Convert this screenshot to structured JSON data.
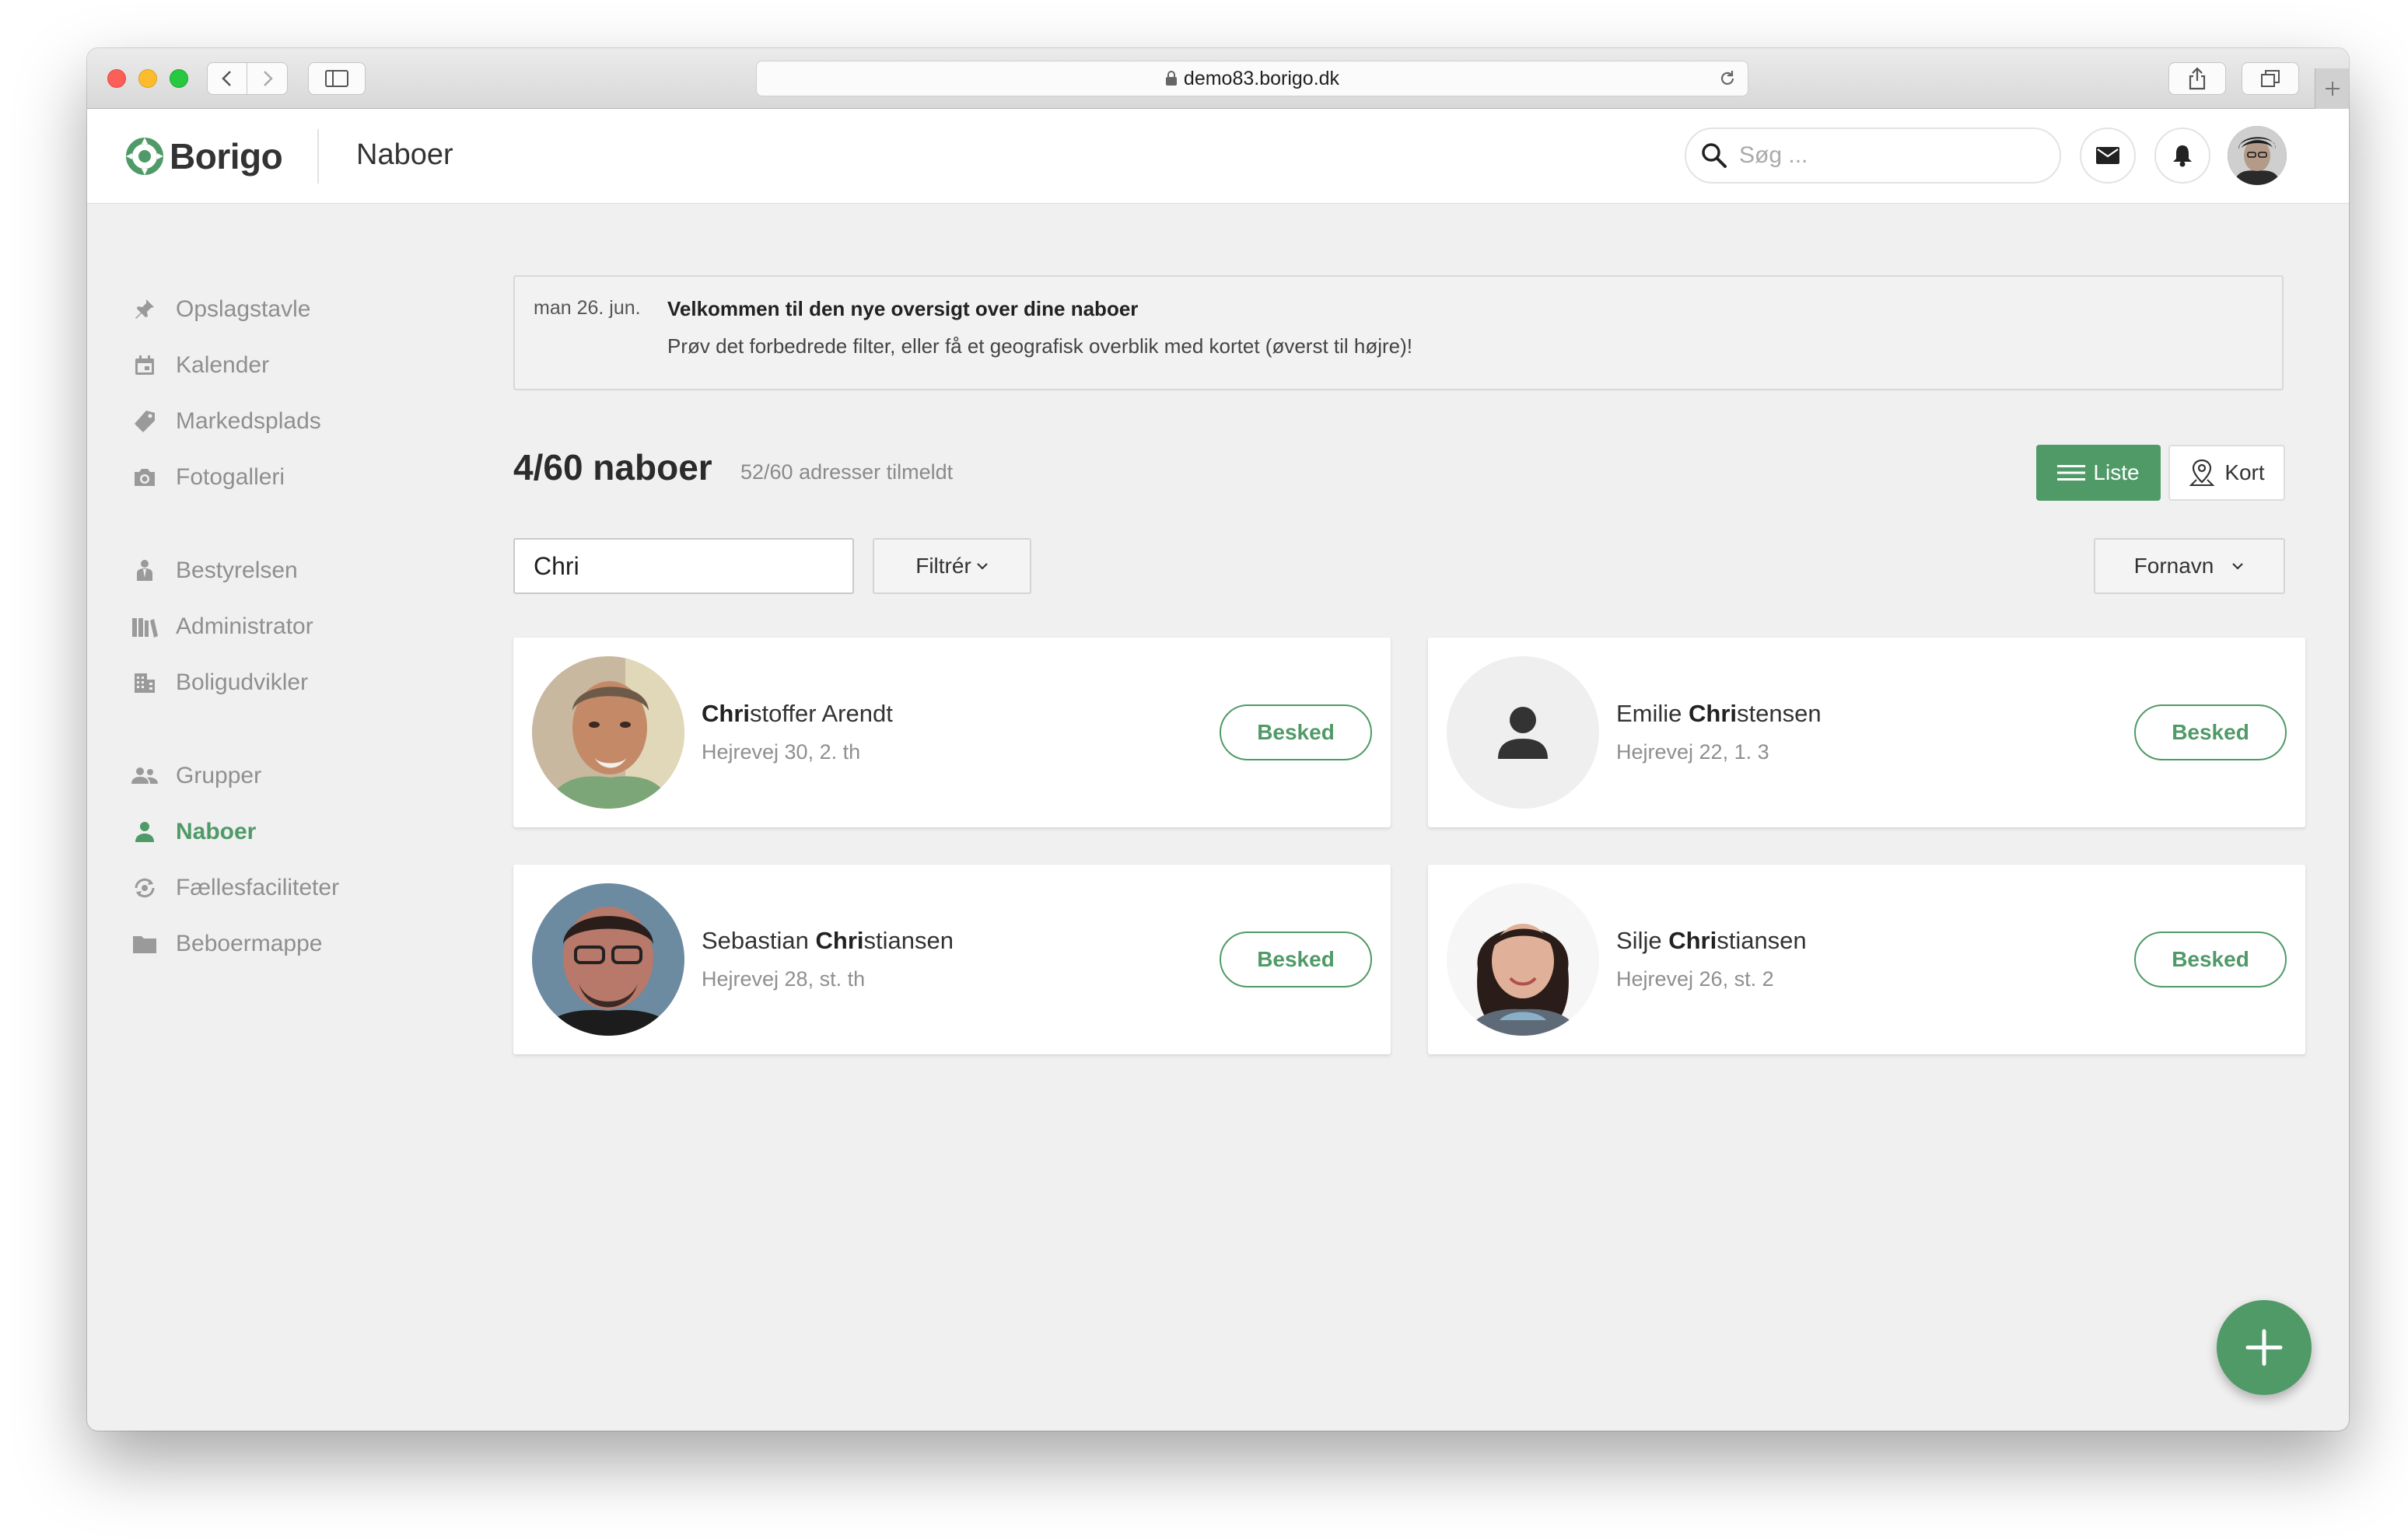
{
  "browser": {
    "url": "demo83.borigo.dk"
  },
  "header": {
    "brand": "Borigo",
    "page_title": "Naboer",
    "search_placeholder": "Søg ..."
  },
  "sidebar": {
    "items": [
      {
        "label": "Opslagstavle",
        "icon": "pin-icon"
      },
      {
        "label": "Kalender",
        "icon": "calendar-icon"
      },
      {
        "label": "Markedsplads",
        "icon": "tag-icon"
      },
      {
        "label": "Fotogalleri",
        "icon": "camera-icon"
      },
      {
        "label": "Bestyrelsen",
        "icon": "board-icon"
      },
      {
        "label": "Administrator",
        "icon": "books-icon"
      },
      {
        "label": "Boligudvikler",
        "icon": "building-icon"
      },
      {
        "label": "Grupper",
        "icon": "group-icon"
      },
      {
        "label": "Naboer",
        "icon": "person-icon",
        "active": true
      },
      {
        "label": "Fællesfaciliteter",
        "icon": "facilities-icon"
      },
      {
        "label": "Beboermappe",
        "icon": "folder-icon"
      }
    ]
  },
  "notice": {
    "date": "man 26. jun.",
    "title": "Velkommen til den nye oversigt over dine naboer",
    "body": "Prøv det forbedrede filter, eller få et geografisk overblik med kortet (øverst til højre)!"
  },
  "summary": {
    "count": "4/60 naboer",
    "sub": "52/60 adresser tilmeldt"
  },
  "view_toggle": {
    "list_label": "Liste",
    "map_label": "Kort",
    "active": "list"
  },
  "filter": {
    "value": "Chri",
    "filter_label": "Filtrér",
    "sort_label": "Fornavn"
  },
  "neighbors": [
    {
      "match": "Chri",
      "rest": "stoffer Arendt",
      "prefix": "",
      "address": "Hejrevej 30, 2. th",
      "button": "Besked",
      "avatar": "photo"
    },
    {
      "prefix": "Emilie ",
      "match": "Chri",
      "rest": "stensen",
      "address": "Hejrevej 22, 1. 3",
      "button": "Besked",
      "avatar": "placeholder"
    },
    {
      "prefix": "Sebastian ",
      "match": "Chri",
      "rest": "stiansen",
      "address": "Hejrevej 28, st. th",
      "button": "Besked",
      "avatar": "photo"
    },
    {
      "prefix": "Silje ",
      "match": "Chri",
      "rest": "stiansen",
      "address": "Hejrevej 26, st. 2",
      "button": "Besked",
      "avatar": "photo"
    }
  ],
  "colors": {
    "accent": "#4f9a67",
    "background": "#f0f0f0"
  }
}
